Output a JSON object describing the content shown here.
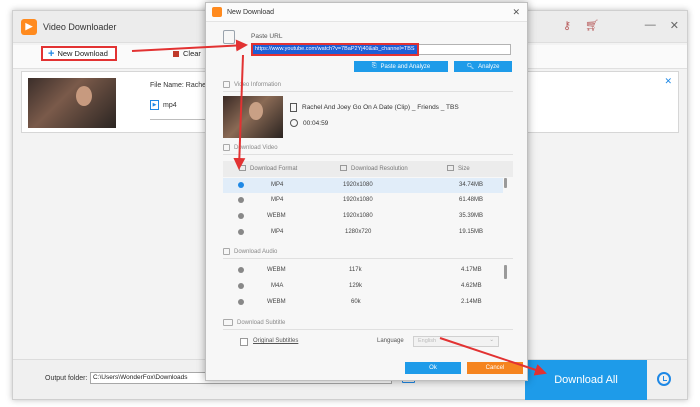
{
  "main": {
    "title": "Video Downloader",
    "toolbar": {
      "new_download": "New Download",
      "clear": "Clear"
    },
    "task": {
      "filename": "File Name: Rachel An",
      "format": "mp4"
    },
    "output_label": "Output folder:",
    "output_path": "C:\\Users\\WonderFox\\Downloads",
    "download_all": "Download All"
  },
  "dialog": {
    "title": "New Download",
    "paste_url_label": "Paste URL",
    "url_value": "https://www.youtube.com/watch?v=7BaP2Yj40&ab_channel=TBS",
    "paste_analyze": "Paste and Analyze",
    "analyze": "Analyze",
    "video_info_label": "Video Information",
    "video_title": "Rachel And Joey Go On A Date (Clip) _ Friends _ TBS",
    "duration": "00:04:59",
    "download_video_label": "Download Video",
    "columns": {
      "format": "Download Format",
      "resolution": "Download Resolution",
      "size": "Size"
    },
    "video_rows": [
      {
        "format": "MP4",
        "resolution": "1920x1080",
        "size": "34.74MB"
      },
      {
        "format": "MP4",
        "resolution": "1920x1080",
        "size": "61.48MB"
      },
      {
        "format": "WEBM",
        "resolution": "1920x1080",
        "size": "35.39MB"
      },
      {
        "format": "MP4",
        "resolution": "1280x720",
        "size": "19.15MB"
      }
    ],
    "download_audio_label": "Download Audio",
    "audio_rows": [
      {
        "format": "WEBM",
        "bitrate": "117k",
        "size": "4.17MB"
      },
      {
        "format": "M4A",
        "bitrate": "129k",
        "size": "4.62MB"
      },
      {
        "format": "WEBM",
        "bitrate": "60k",
        "size": "2.14MB"
      }
    ],
    "download_subtitle_label": "Download Subtitle",
    "original_subtitles": "Original Subtitles",
    "language_label": "Language",
    "language_value": "English",
    "ok": "Ok",
    "cancel": "Cancel"
  },
  "colors": {
    "accent": "#1e9be9",
    "annotation_red": "#e23232",
    "cancel_orange": "#f5841f"
  }
}
